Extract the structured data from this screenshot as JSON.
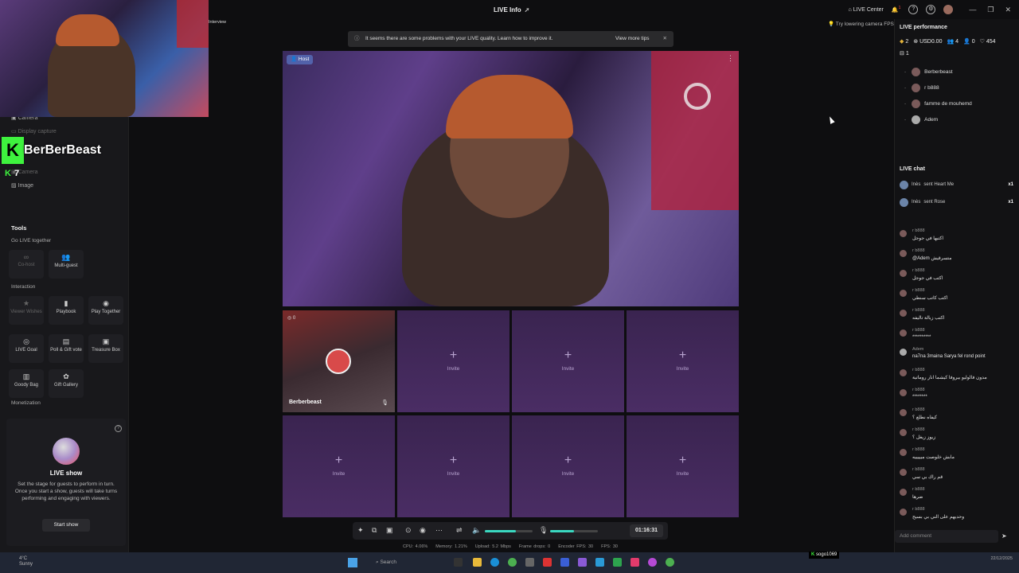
{
  "topbar": {
    "title": "LIVE Info",
    "live_center": "LIVE Center",
    "notif_badge": "1"
  },
  "banner": {
    "text": "It seems there are some problems with your LIVE quality. Learn how to improve it.",
    "tips": "View more tips"
  },
  "camera_fps_hint": "Try lowering camera FPS",
  "overlay": {
    "webcam_tag": "Interview",
    "kick_name": "BerBerBeast",
    "kick_viewers": "7"
  },
  "sidebar": {
    "sources": [
      "Camera",
      "Display capture",
      "Camera",
      "Image"
    ],
    "tools_title": "Tools",
    "go_live_together": "Go LIVE together",
    "interaction": "Interaction",
    "monetization": "Monetization",
    "tools": {
      "cohost": "Co-host",
      "multiguest": "Multi-guest",
      "viewer_wishes": "Viewer Wishes",
      "playbook": "Playbook",
      "play_together": "Play Together",
      "live_goal": "LIVE Goal",
      "poll_gift_vote": "Poll & Gift vote",
      "treasure_box": "Treasure Box",
      "goody_bag": "Goody Bag",
      "gift_gallery": "Gift Gallery"
    },
    "liveshow": {
      "title": "LIVE show",
      "desc": "Set the stage for guests to perform in turn. Once you start a show, guests will take turns performing and engaging with viewers.",
      "button": "Start show"
    }
  },
  "main": {
    "host_tag": "Host",
    "guest1_name": "Berberbeast",
    "guest1_count": "0",
    "invite_label": "Invite"
  },
  "controls": {
    "timer": "01:16:31",
    "volume": 0.65,
    "mic": 0.5
  },
  "stats": {
    "cpu": "CPU: 4.06%",
    "memory": "Memory: 1.21%",
    "upload": "Upload: 5.2 Mbps",
    "frame_drops": "Frame drops: 0",
    "encoder_fps": "Encoder FPS: 30",
    "fps": "FPS: 30"
  },
  "right": {
    "perf_title": "LIVE performance",
    "stat_gold": "2",
    "stat_usd": "USD0.00",
    "stat_people": "4",
    "stat_follow": "0",
    "stat_likes": "454",
    "stat_gifts": "1",
    "viewers": [
      "Berberbeast",
      "r b888",
      "famme de mouhemd",
      "Adem"
    ],
    "chat_title": "LIVE chat",
    "gifts": [
      {
        "user": "Inès",
        "text": "sent Heart Me",
        "count": "x1"
      },
      {
        "user": "Inès",
        "text": "sent Rose",
        "count": "x1"
      }
    ],
    "messages": [
      {
        "name": "r b888",
        "text": "اكتبها في جوجل"
      },
      {
        "name": "r b888",
        "text": "@Adem متسرقيش"
      },
      {
        "name": "r b888",
        "text": "اكتب في جوجل"
      },
      {
        "name": "r b888",
        "text": "اكتب كاتب سنطي"
      },
      {
        "name": "r b888",
        "text": "اكتب زبالة تاليفه"
      },
      {
        "name": "r b888",
        "text": "**********"
      },
      {
        "name": "Adem",
        "text": "na7na 3maina Sarya fel rond point"
      },
      {
        "name": "r b888",
        "text": "مدون فالوليو بيروفا كيشما انار روماتية"
      },
      {
        "name": "r b888",
        "text": "********"
      },
      {
        "name": "r b888",
        "text": "كيفاه نطلع ؟"
      },
      {
        "name": "r b888",
        "text": "زيوز زيغل ؟"
      },
      {
        "name": "r b888",
        "text": "مابش خلوصت ميييييه"
      },
      {
        "name": "r b888",
        "text": "قم راك بي سي"
      },
      {
        "name": "r b888",
        "text": "ضرها"
      },
      {
        "name": "r b888",
        "text": "وحديهم على الني بي بسيح"
      }
    ],
    "chat_placeholder": "Add comment"
  },
  "taskbar": {
    "temp": "4°C",
    "weather": "Sunny",
    "search": "Search",
    "kick_user": "sogo1069",
    "date": "22/12/2025"
  }
}
